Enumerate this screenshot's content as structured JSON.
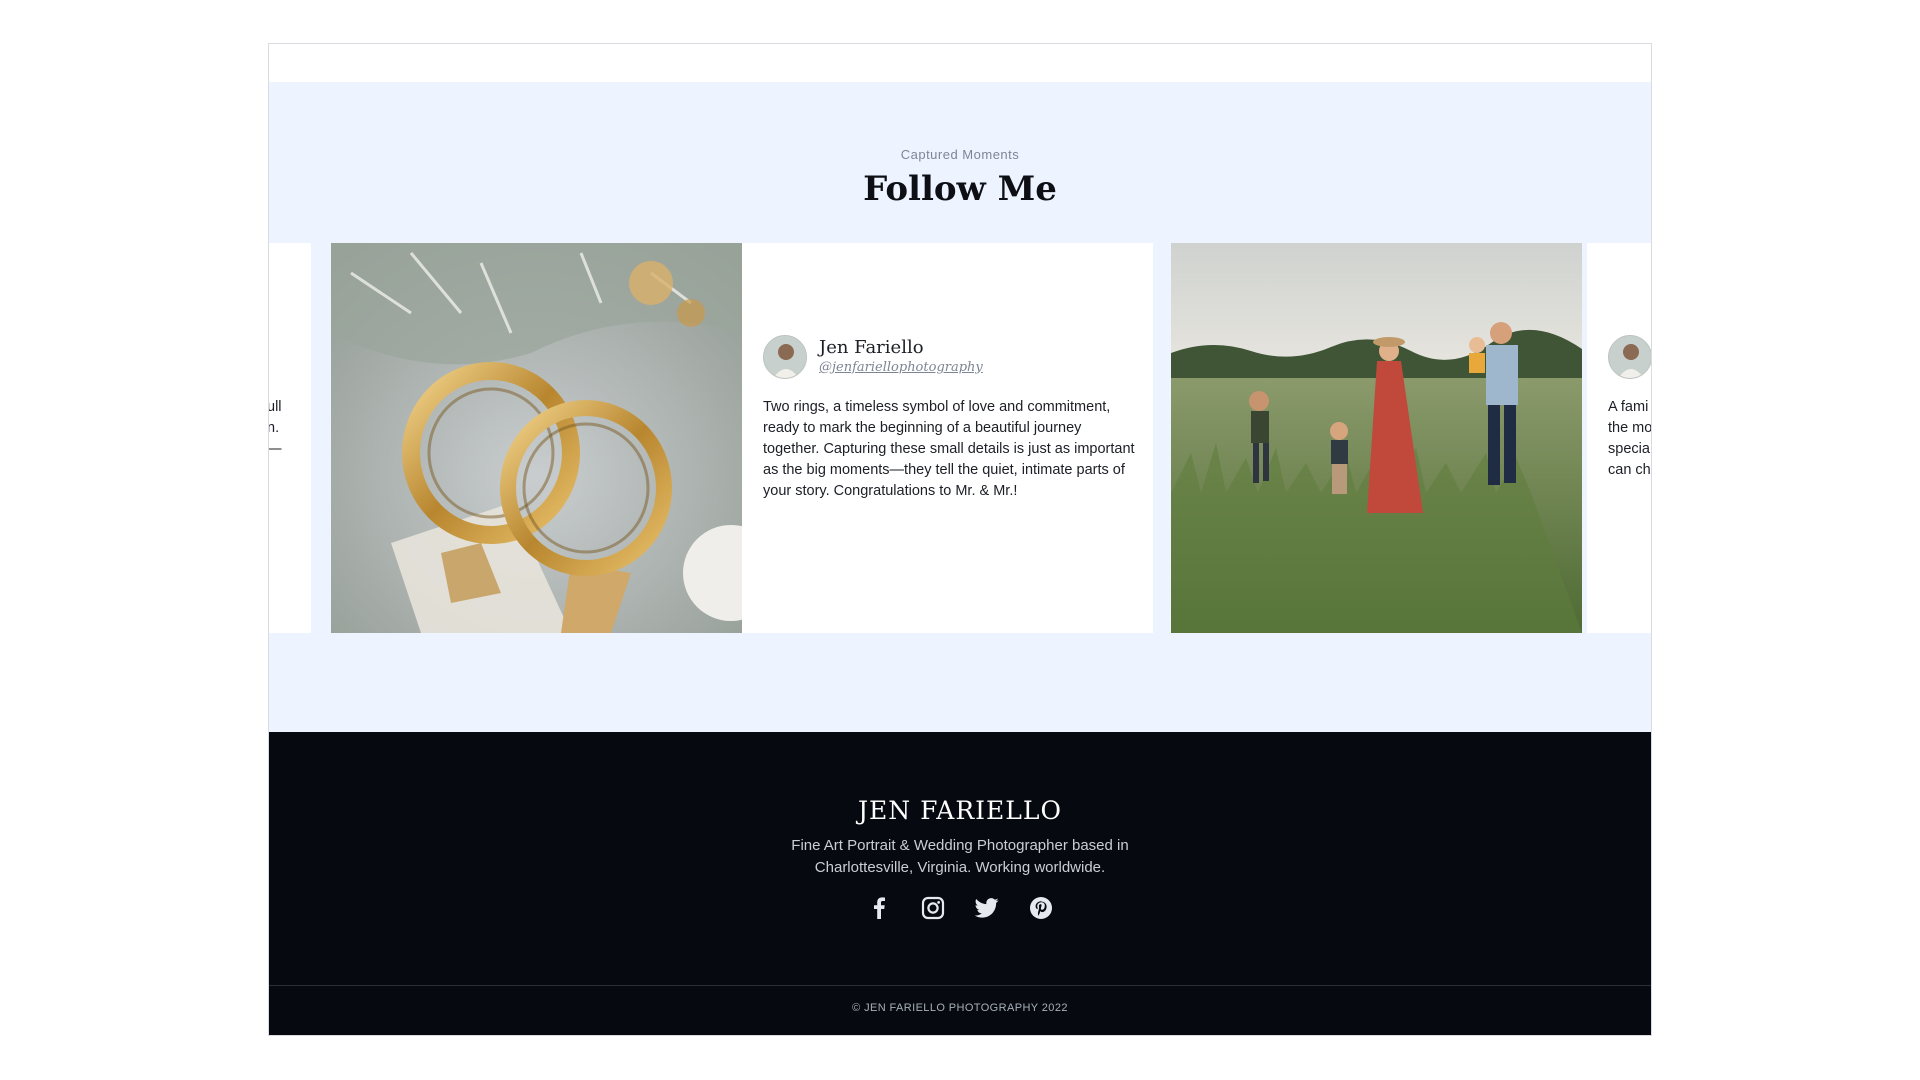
{
  "section": {
    "eyebrow": "Captured Moments",
    "title": "Follow Me"
  },
  "posts": [
    {
      "author_name": "Jen Fariello",
      "author_handle": "@jenfariellophotography",
      "caption": "Two rings, a timeless symbol of love and commitment, ready to mark the beginning of a beautiful journey together. Capturing these small details is just as important as the big moments—they tell the quiet, intimate parts of your story. Congratulations to Mr. & Mr.!"
    }
  ],
  "partial_left_caption": "ull\nn.\n—",
  "partial_right_caption": "A fami\nthe mo\nspecia\ncan ch",
  "footer": {
    "brand": "JEN FARIELLO",
    "tagline": "Fine Art Portrait & Wedding Photographer based in Charlottesville, Virginia. Working worldwide.",
    "social_icons": [
      "facebook-icon",
      "instagram-icon",
      "twitter-icon",
      "pinterest-icon"
    ],
    "copyright": "© JEN FARIELLO PHOTOGRAPHY  2022"
  },
  "colors": {
    "section_bg": "#eef4ff",
    "footer_bg": "#060a10",
    "text_dark": "#0d0f14",
    "muted": "#7d8594"
  }
}
